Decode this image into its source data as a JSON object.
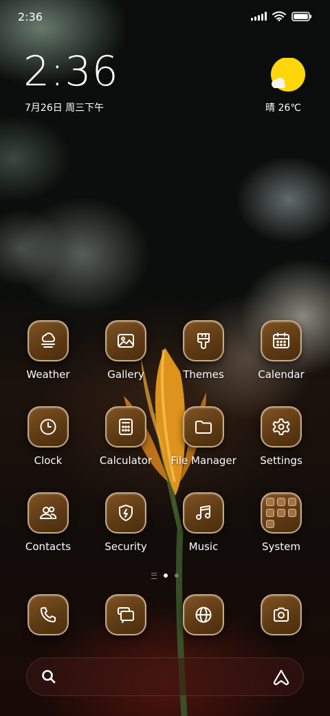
{
  "status_bar": {
    "time": "2:36"
  },
  "clock_widget": {
    "time": "2:36",
    "date": "7月26日 周三下午"
  },
  "weather_widget": {
    "text": "晴 26℃"
  },
  "apps": [
    {
      "label": "Weather",
      "icon": "weather-icon"
    },
    {
      "label": "Gallery",
      "icon": "gallery-icon"
    },
    {
      "label": "Themes",
      "icon": "themes-icon"
    },
    {
      "label": "Calendar",
      "icon": "calendar-icon"
    },
    {
      "label": "Clock",
      "icon": "clock-icon"
    },
    {
      "label": "Calculator",
      "icon": "calculator-icon"
    },
    {
      "label": "File Manager",
      "icon": "folder-icon"
    },
    {
      "label": "Settings",
      "icon": "gear-icon"
    },
    {
      "label": "Contacts",
      "icon": "contacts-icon"
    },
    {
      "label": "Security",
      "icon": "shield-icon"
    },
    {
      "label": "Music",
      "icon": "music-icon"
    },
    {
      "label": "System",
      "icon": "folder-grid-icon"
    }
  ],
  "dock": [
    {
      "icon": "phone-icon"
    },
    {
      "icon": "messages-icon"
    },
    {
      "icon": "browser-icon"
    },
    {
      "icon": "camera-icon"
    }
  ],
  "pager": {
    "pages": 2,
    "active": 1
  },
  "colors": {
    "icon_bg": "#6b4419",
    "icon_border": "#e1cdaf",
    "sun": "#ffd60a"
  }
}
